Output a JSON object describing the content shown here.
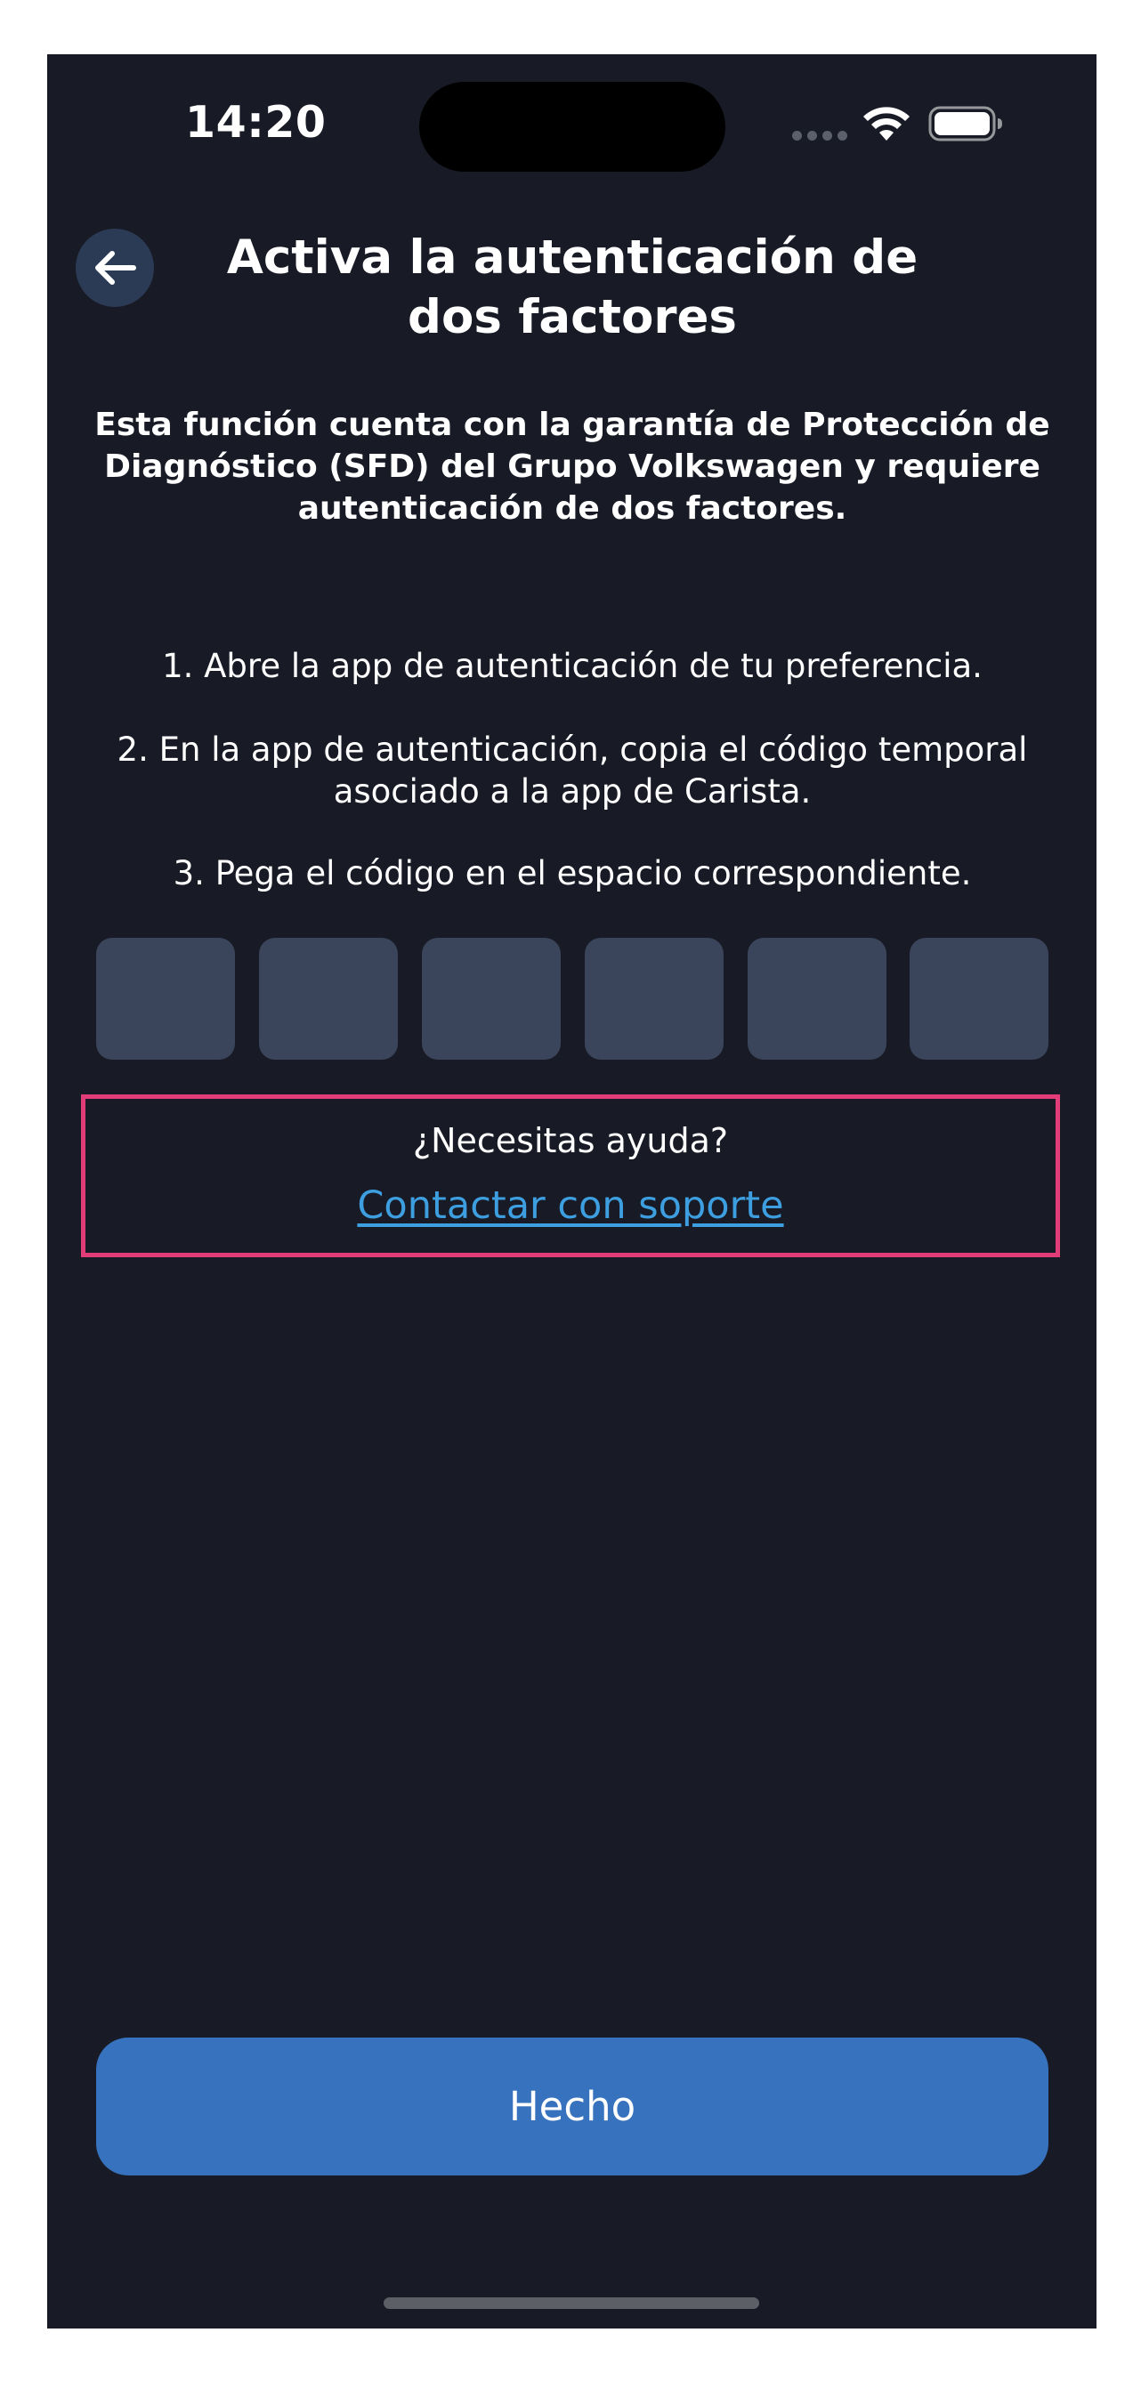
{
  "status_bar": {
    "time": "14:20"
  },
  "header": {
    "back_icon": "arrow-left-icon",
    "title": "Activa la autenticación de dos factores"
  },
  "content": {
    "intro": "Esta función cuenta con la garantía de Protección de Diagnóstico (SFD) del Grupo Volkswagen y requiere autenticación de dos factores.",
    "steps": [
      "1. Abre la app de autenticación de tu preferencia.",
      "2. En la app de autenticación, copia el código temporal asociado a la app de Carista.",
      "3. Pega el código en el espacio correspondiente."
    ],
    "code_digits": [
      "",
      "",
      "",
      "",
      "",
      ""
    ]
  },
  "help": {
    "question": "¿Necesitas ayuda?",
    "link_label": "Contactar con soporte"
  },
  "footer": {
    "done_label": "Hecho"
  },
  "colors": {
    "background": "#181b25",
    "code_box": "#3a445a",
    "highlight_border": "#e23d78",
    "link": "#3d9ee0",
    "primary_button": "#3672bd"
  }
}
